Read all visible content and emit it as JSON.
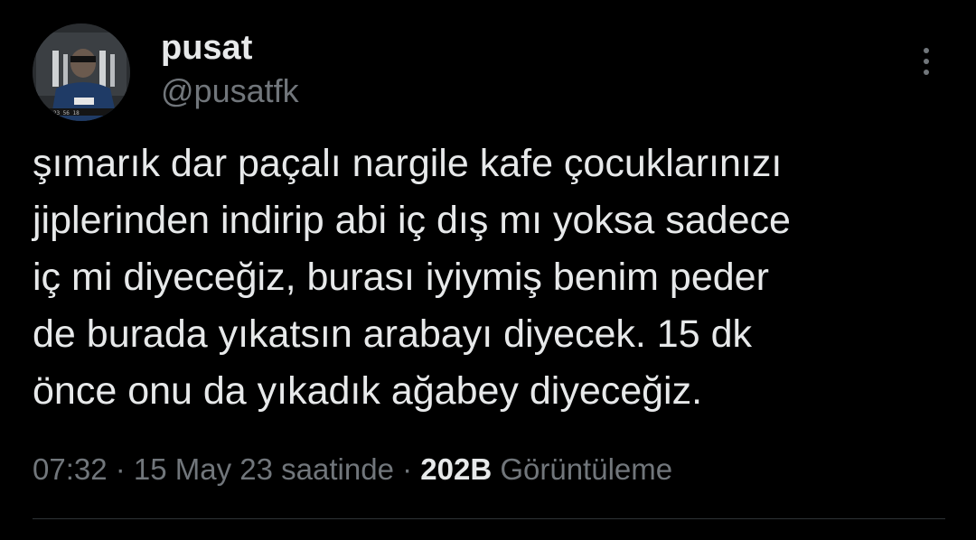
{
  "author": {
    "display_name": "pusat",
    "handle": "@pusatfk",
    "avatar_icon": "profile-photo"
  },
  "tweet": {
    "text": "şımarık dar paçalı nargile kafe çocuklarınızı\njiplerinden indirip abi iç dış mı yoksa sadece\niç mi diyeceğiz, burası iyiymiş benim peder\nde burada yıkatsın arabayı diyecek. 15 dk\nönce onu da yıkadık ağabey diyeceğiz."
  },
  "meta": {
    "time": "07:32",
    "sep1": " · ",
    "date": "15 May 23 saatinde",
    "sep2": " · ",
    "views_count": "202B",
    "views_label": " Görüntüleme"
  },
  "more_icon": "more-vertical-icon",
  "colors": {
    "background": "#000000",
    "primary_text": "#e7e9ea",
    "secondary_text": "#71767b",
    "divider": "#2f3336"
  }
}
